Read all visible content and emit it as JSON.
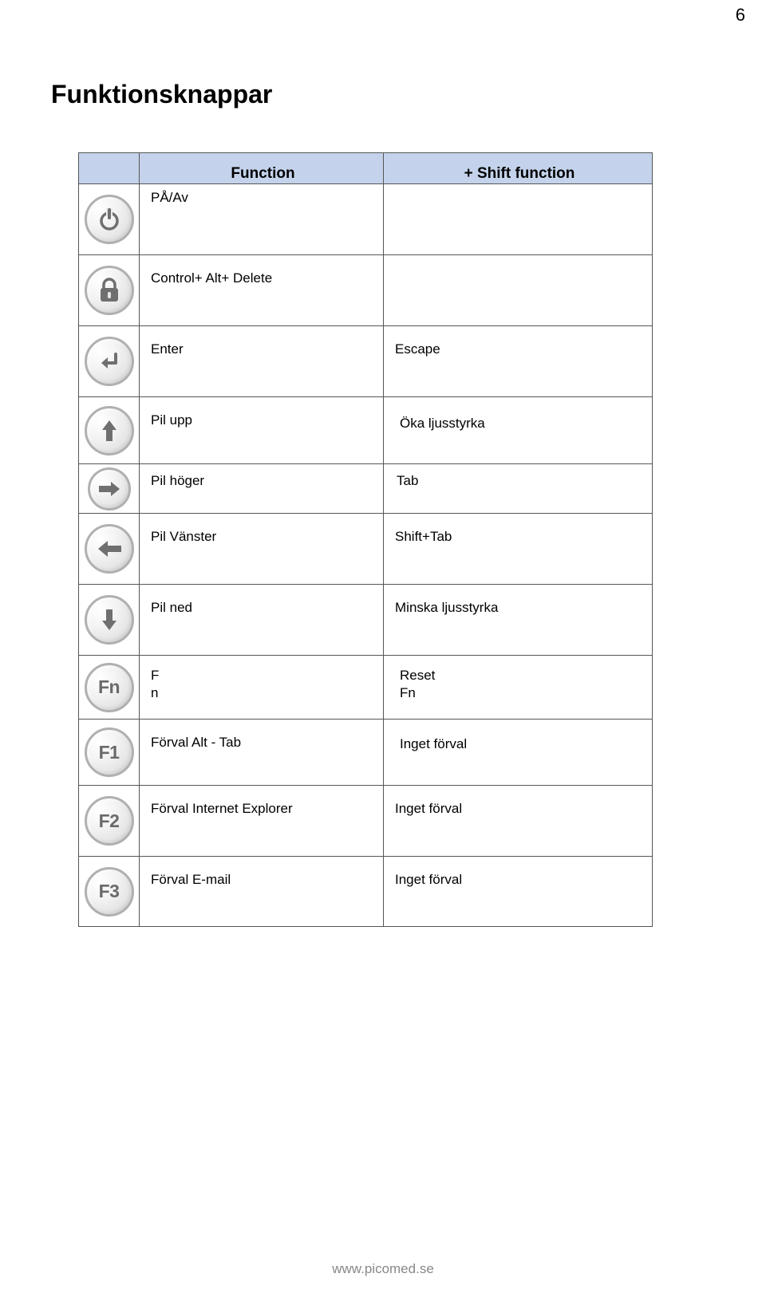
{
  "page_number": "6",
  "title": "Funktionsknappar",
  "header": {
    "function": "Function",
    "shift": "+ Shift function"
  },
  "rows": [
    {
      "icon": "power",
      "func": "PÅ/Av",
      "shift": ""
    },
    {
      "icon": "lock",
      "func": "Control+ Alt+ Delete",
      "shift": ""
    },
    {
      "icon": "enter",
      "func": "Enter",
      "shift": "Escape"
    },
    {
      "icon": "arrow-up",
      "func": "Pil upp",
      "shift": "Öka ljusstyrka"
    },
    {
      "icon": "arrow-right",
      "func": "Pil höger",
      "shift": "Tab"
    },
    {
      "icon": "arrow-left",
      "func": "Pil Vänster",
      "shift": "Shift+Tab"
    },
    {
      "icon": "arrow-down",
      "func": "Pil ned",
      "shift": "Minska ljusstyrka"
    },
    {
      "icon": "Fn",
      "func": "F",
      "func2": "n",
      "shift": "Reset",
      "shift2": "Fn"
    },
    {
      "icon": "F1",
      "func": "Förval Alt - Tab",
      "shift": "Inget förval"
    },
    {
      "icon": "F2",
      "func": "Förval Internet Explorer",
      "shift": "Inget förval"
    },
    {
      "icon": "F3",
      "func": "Förval  E-mail",
      "shift": "Inget förval"
    }
  ],
  "footer": "www.picomed.se"
}
